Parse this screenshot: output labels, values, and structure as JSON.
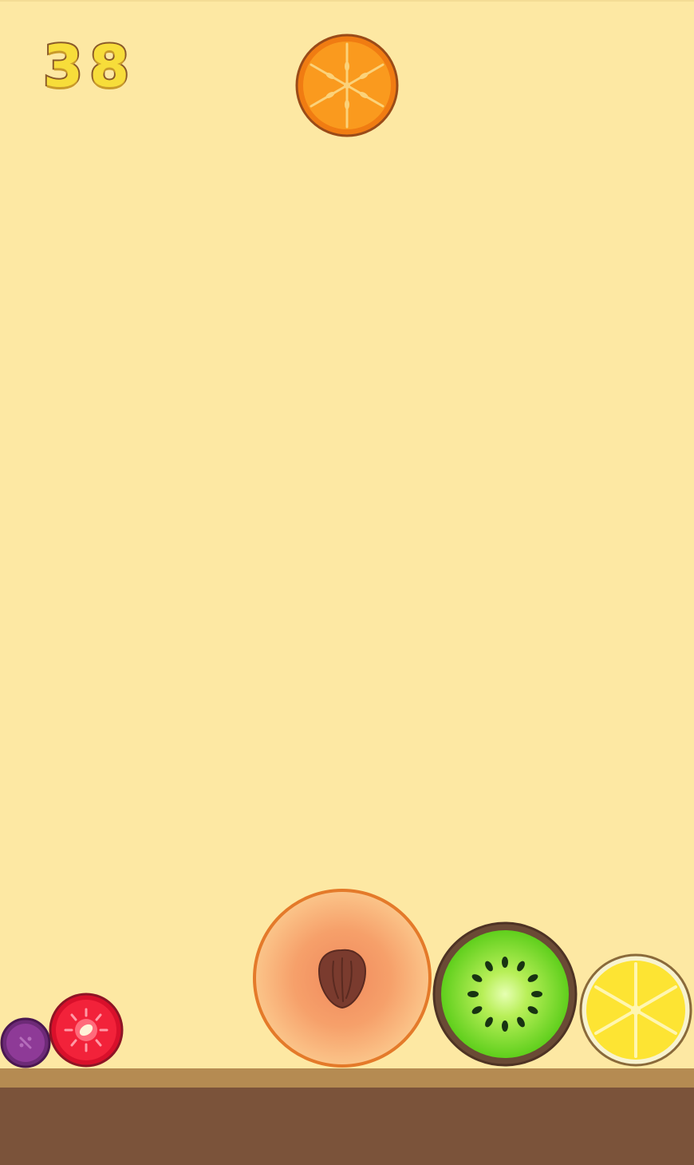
{
  "game": {
    "score": "38",
    "next_fruit": "orange",
    "fruits": [
      "grape",
      "cherry",
      "peach",
      "kiwi",
      "lemon"
    ],
    "colors": {
      "background": "#fde8a3",
      "ground": "#7b533a",
      "ground_top": "#b58b52",
      "score_fill": "#f7dd3a",
      "score_stroke": "#8a5a2a"
    }
  }
}
